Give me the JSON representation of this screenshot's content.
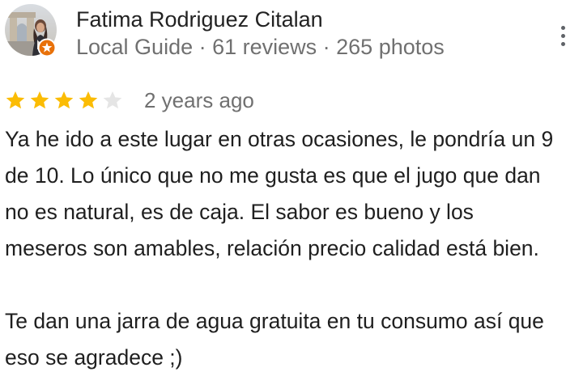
{
  "author": {
    "name": "Fatima Rodriguez Citalan",
    "meta": "Local Guide · 61 reviews · 265 photos",
    "avatar_icon": "user-photo",
    "badge_icon": "local-guide-badge",
    "badge_color": "#E8710A"
  },
  "review": {
    "rating": 4,
    "max_rating": 5,
    "star_color": "#FBBC04",
    "empty_star_color": "#E5E5E5",
    "date": "2 years ago",
    "lines": [
      "Ya he ido a este lugar en otras ocasiones, le pondría un 9",
      "de 10. Lo único que no me gusta es que el jugo que dan",
      "no es natural, es de caja. El sabor es bueno y los",
      "meseros son amables, relación precio calidad está bien.",
      "",
      "Te dan una jarra de agua gratuita en tu consumo así que",
      "eso se agradece ;)"
    ]
  },
  "menu": {
    "more_icon": "more-vert-icon"
  }
}
